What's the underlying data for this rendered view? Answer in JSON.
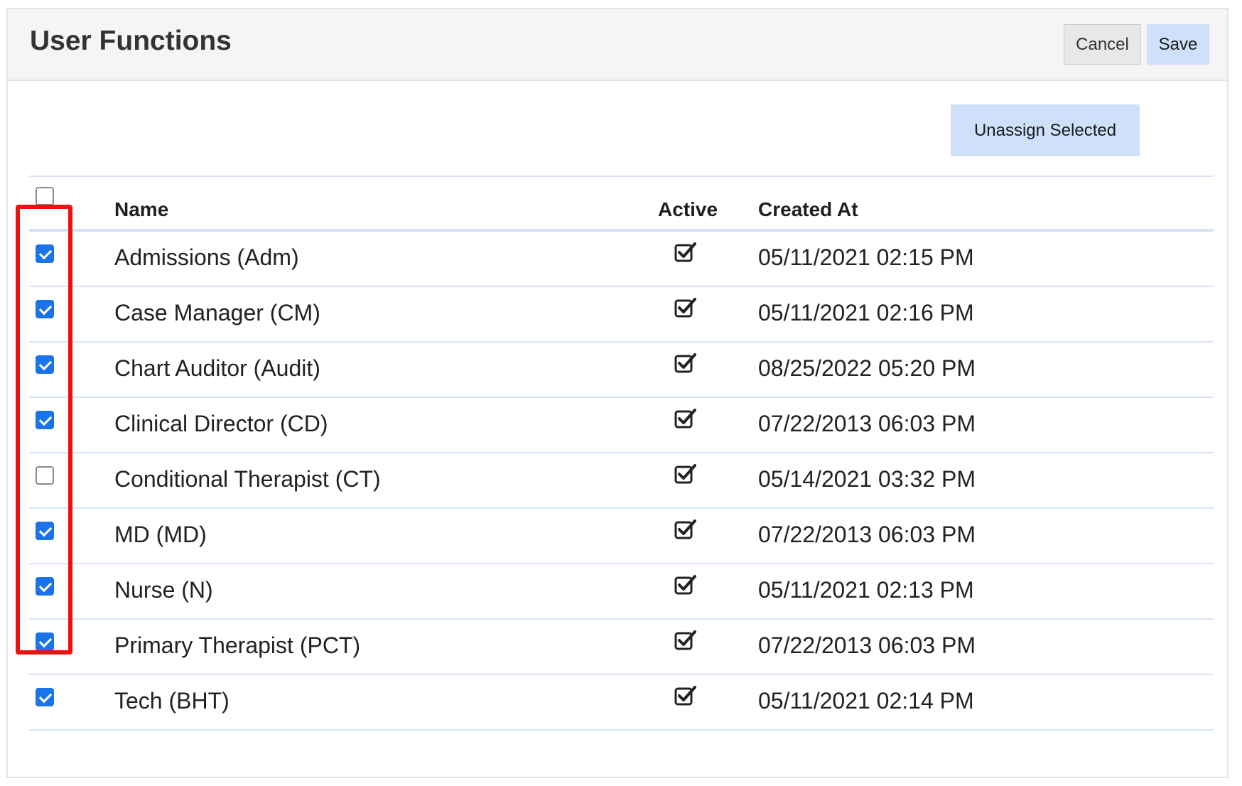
{
  "header": {
    "title": "User Functions",
    "cancel_label": "Cancel",
    "save_label": "Save"
  },
  "toolbar": {
    "unassign_label": "Unassign Selected"
  },
  "table": {
    "columns": {
      "select_all_checked": false,
      "name": "Name",
      "active": "Active",
      "created_at": "Created At"
    },
    "active_icon": "check-square-icon",
    "rows": [
      {
        "name": "Admissions (Adm)",
        "active": true,
        "created_at": "05/11/2021 02:15 PM",
        "selected": true
      },
      {
        "name": "Case Manager (CM)",
        "active": true,
        "created_at": "05/11/2021 02:16 PM",
        "selected": true
      },
      {
        "name": "Chart Auditor (Audit)",
        "active": true,
        "created_at": "08/25/2022 05:20 PM",
        "selected": true
      },
      {
        "name": "Clinical Director (CD)",
        "active": true,
        "created_at": "07/22/2013 06:03 PM",
        "selected": true
      },
      {
        "name": "Conditional Therapist (CT)",
        "active": true,
        "created_at": "05/14/2021 03:32 PM",
        "selected": false
      },
      {
        "name": "MD (MD)",
        "active": true,
        "created_at": "07/22/2013 06:03 PM",
        "selected": true
      },
      {
        "name": "Nurse (N)",
        "active": true,
        "created_at": "05/11/2021 02:13 PM",
        "selected": true
      },
      {
        "name": "Primary Therapist (PCT)",
        "active": true,
        "created_at": "07/22/2013 06:03 PM",
        "selected": true
      },
      {
        "name": "Tech (BHT)",
        "active": true,
        "created_at": "05/11/2021 02:14 PM",
        "selected": true
      }
    ]
  },
  "colors": {
    "header_bg": "#f5f5f5",
    "primary_button": "#cfe1fa",
    "checkbox_checked": "#1a73e8",
    "row_divider": "#d7e4f5",
    "annotation_outline": "#ee1111"
  }
}
